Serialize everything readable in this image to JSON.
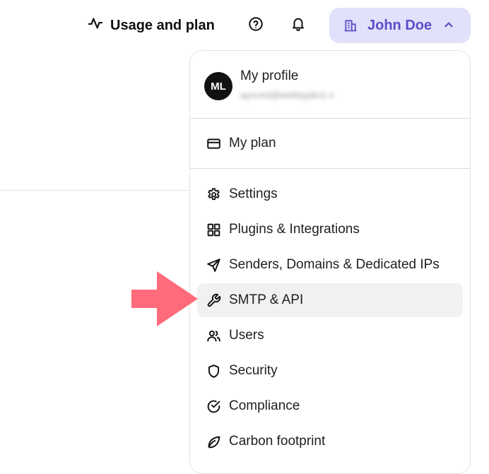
{
  "header": {
    "usage_label": "Usage and plan",
    "account_name": "John Doe"
  },
  "menu": {
    "profile": {
      "initials": "ML",
      "title": "My profile",
      "email": "ayrcred@webbyplin1.n"
    },
    "my_plan": "My plan",
    "items": [
      {
        "label": "Settings",
        "icon": "gear-icon"
      },
      {
        "label": "Plugins & Integrations",
        "icon": "grid-icon"
      },
      {
        "label": "Senders, Domains & Dedicated IPs",
        "icon": "send-icon"
      },
      {
        "label": "SMTP & API",
        "icon": "wrench-icon"
      },
      {
        "label": "Users",
        "icon": "users-icon"
      },
      {
        "label": "Security",
        "icon": "shield-icon"
      },
      {
        "label": "Compliance",
        "icon": "check-circle-icon"
      },
      {
        "label": "Carbon footprint",
        "icon": "leaf-icon"
      }
    ]
  },
  "colors": {
    "accent": "#5a4dc7",
    "accent_bg": "#e2e1fb",
    "arrow": "#ff6b7a"
  }
}
